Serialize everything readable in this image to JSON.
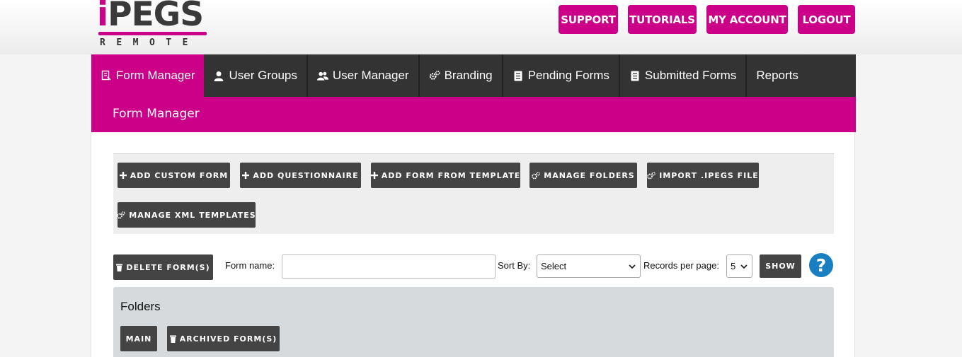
{
  "logo": {
    "word_prefix": "i",
    "word_rest": "PEGS",
    "sub": "REMOTE"
  },
  "header": {
    "buttons": [
      "SUPPORT",
      "TUTORIALS",
      "MY ACCOUNT",
      "LOGOUT"
    ]
  },
  "nav": {
    "items": [
      {
        "label": "Form Manager",
        "icon": "form-icon"
      },
      {
        "label": "User Groups",
        "icon": "user-icon"
      },
      {
        "label": "User Manager",
        "icon": "users-icon"
      },
      {
        "label": "Branding",
        "icon": "gears-icon"
      },
      {
        "label": "Pending Forms",
        "icon": "document-icon"
      },
      {
        "label": "Submitted Forms",
        "icon": "document-icon"
      },
      {
        "label": "Reports",
        "icon": ""
      }
    ]
  },
  "page": {
    "title": "Form Manager"
  },
  "actions": {
    "add_custom_form": "ADD CUSTOM FORM",
    "add_questionnaire": "ADD QUESTIONNAIRE",
    "add_from_template": "ADD FORM FROM TEMPLATE",
    "manage_folders": "MANAGE FOLDERS",
    "import_file": "IMPORT .IPEGS FILE",
    "manage_xml": "MANAGE XML TEMPLATES"
  },
  "filters": {
    "delete_label": "DELETE FORM(S)",
    "form_name_label": "Form name:",
    "form_name_value": "",
    "sort_by_label": "Sort By:",
    "sort_by_value": "Select",
    "records_label": "Records per page:",
    "records_value": "5",
    "show_label": "SHOW",
    "help": "?"
  },
  "folders": {
    "title": "Folders",
    "main": "MAIN",
    "archived": "ARCHIVED FORM(S)"
  },
  "colors": {
    "brand": "#cc0088",
    "nav_bg": "#333333",
    "button_bg": "#444444",
    "help": "#1a7fc1"
  }
}
